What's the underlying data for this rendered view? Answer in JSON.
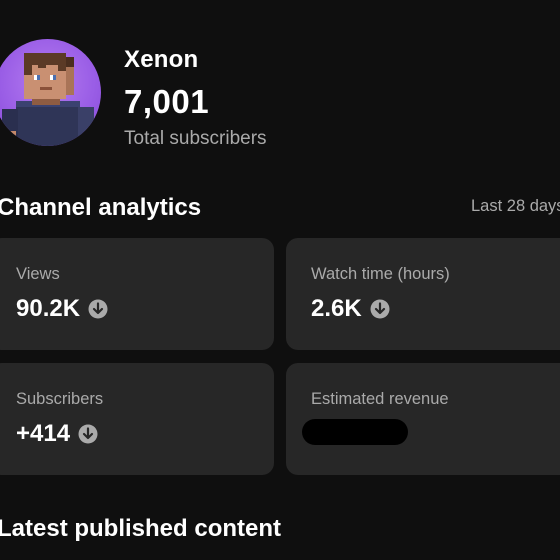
{
  "channel": {
    "name": "Xenon",
    "subscriber_count": "7,001",
    "subscriber_label": "Total subscribers",
    "avatar_icon": "minecraft-skin-avatar",
    "avatar_bg_color": "#9a5ee6"
  },
  "analytics": {
    "title": "Channel analytics",
    "period": "Last 28 days",
    "cards": [
      {
        "label": "Views",
        "value": "90.2K",
        "trend_icon": "arrow-down-circle-icon"
      },
      {
        "label": "Watch time (hours)",
        "value": "2.6K",
        "trend_icon": "arrow-down-circle-icon"
      },
      {
        "label": "Subscribers",
        "value": "+414",
        "trend_icon": "arrow-down-circle-icon"
      },
      {
        "label": "Estimated revenue",
        "value_redacted": true
      }
    ],
    "trend_icon_color": "#aaaaaa"
  },
  "latest": {
    "title": "Latest published content"
  },
  "colors": {
    "background": "#0f0f0f",
    "card": "#272727",
    "secondary_text": "#aaaaaa",
    "primary_text": "#ffffff"
  }
}
